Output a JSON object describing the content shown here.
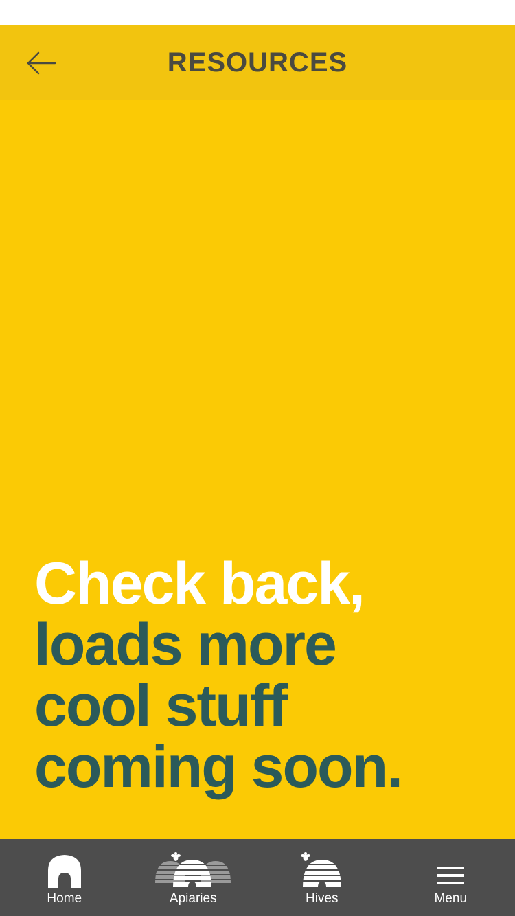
{
  "header": {
    "title": "RESOURCES",
    "back_icon": "arrow-left-icon",
    "background": "#f2c40f",
    "title_color": "#4a4a40"
  },
  "content": {
    "background": "#fbca05",
    "message_lines": [
      {
        "text": "Check back,",
        "color": "#ffffff"
      },
      {
        "text": "loads more",
        "color": "#2b5a5a"
      },
      {
        "text": "cool stuff",
        "color": "#2b5a5a"
      },
      {
        "text": "coming soon.",
        "color": "#2b5a5a"
      }
    ]
  },
  "tabbar": {
    "background": "#4d4d4d",
    "tabs": [
      {
        "label": "Home",
        "icon": "home-icon"
      },
      {
        "label": "Apiaries",
        "icon": "apiaries-icon"
      },
      {
        "label": "Hives",
        "icon": "hive-icon"
      },
      {
        "label": "Menu",
        "icon": "hamburger-menu-icon"
      }
    ]
  }
}
